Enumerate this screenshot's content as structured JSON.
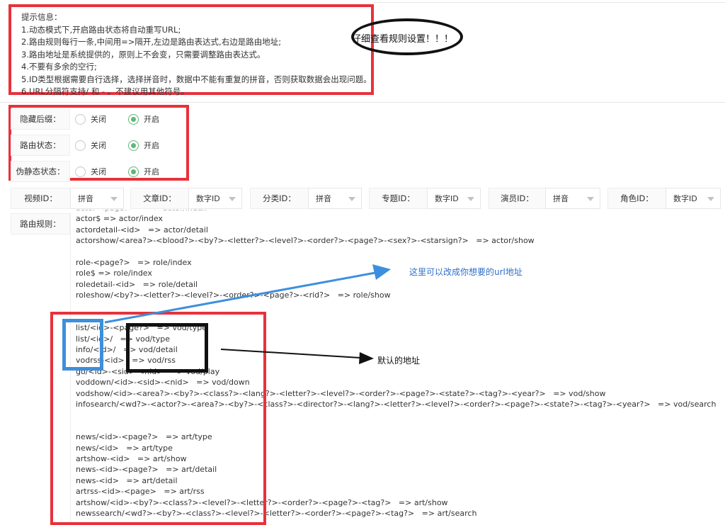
{
  "notice": {
    "title": "提示信息：",
    "lines": [
      "1.动态模式下,开启路由状态将自动重写URL;",
      "2.路由规则每行一条,中间用=>隔开,左边是路由表达式,右边是路由地址;",
      "3.路由地址是系统提供的，原则上不会变，只需要调整路由表达式。",
      "4.不要有多余的空行;",
      "5.ID类型根据需要自行选择，选择拼音时，数据中不能有重复的拼音，否则获取数据会出现问题。",
      "6.URL分隔符支持/ 和 - 。不建议用其他符号。"
    ]
  },
  "ellipse_note": "仔细查看规则设置！！！",
  "settings": [
    {
      "label": "隐藏后缀：",
      "off": "关闭",
      "on": "开启",
      "selected": "on"
    },
    {
      "label": "路由状态：",
      "off": "关闭",
      "on": "开启",
      "selected": "on"
    },
    {
      "label": "伪静态状态：",
      "off": "关闭",
      "on": "开启",
      "selected": "on"
    }
  ],
  "id_types": [
    {
      "label": "视频ID：",
      "value": "拼音"
    },
    {
      "label": "文章ID：",
      "value": "数字ID"
    },
    {
      "label": "分类ID：",
      "value": "拼音"
    },
    {
      "label": "专题ID：",
      "value": "数字ID"
    },
    {
      "label": "演员ID：",
      "value": "拼音"
    },
    {
      "label": "角色ID：",
      "value": "数字ID"
    }
  ],
  "route_label": "路由规则：",
  "rules": [
    "actor-<page?>     => actor/index",
    "actor$ => actor/index",
    "actordetail-<id>   => actor/detail",
    "actorshow/<area?>-<blood?>-<by?>-<letter?>-<level?>-<order?>-<page?>-<sex?>-<starsign?>   => actor/show",
    "",
    "role-<page?>   => role/index",
    "role$ => role/index",
    "roledetail-<id>   => role/detail",
    "roleshow/<by?>-<letter?>-<level?>-<order?>-<page?>-<rid?>   => role/show",
    "",
    "",
    "list/<id>-<page?>   => vod/type",
    "list/<id>/   => vod/type",
    "info/<id>/   => vod/detail",
    "vodrss-<id>   => vod/rss",
    "go/<id>-<sid>-<nid>   => vod/play",
    "voddown/<id>-<sid>-<nid>   => vod/down",
    "vodshow/<id>-<area?>-<by?>-<class?>-<lang?>-<letter?>-<level?>-<order?>-<page?>-<state?>-<tag?>-<year?>   => vod/show",
    "infosearch/<wd?>-<actor?>-<area?>-<by?>-<class?>-<director?>-<lang?>-<letter?>-<level?>-<order?>-<page?>-<state?>-<tag?>-<year?>   => vod/search",
    "",
    "",
    "news/<id>-<page?>   => art/type",
    "news/<id>   => art/type",
    "artshow-<id>   => art/show",
    "news-<id>-<page?>   => art/detail",
    "news-<id>   => art/detail",
    "artrss-<id>-<page>   => art/rss",
    "artshow/<id>-<by?>-<class?>-<level?>-<letter?>-<order?>-<page?>-<tag?>   => art/show",
    "newssearch/<wd?>-<by?>-<class?>-<level?>-<letter?>-<order?>-<page?>-<tag?>   => art/search"
  ],
  "annotations": {
    "blue_note": "这里可以改成你想要的url地址",
    "black_note": "默认的地址"
  },
  "colors": {
    "annotation_red": "#e8313b",
    "annotation_blue": "#3d8fdd",
    "radio_green": "#5fb878"
  }
}
